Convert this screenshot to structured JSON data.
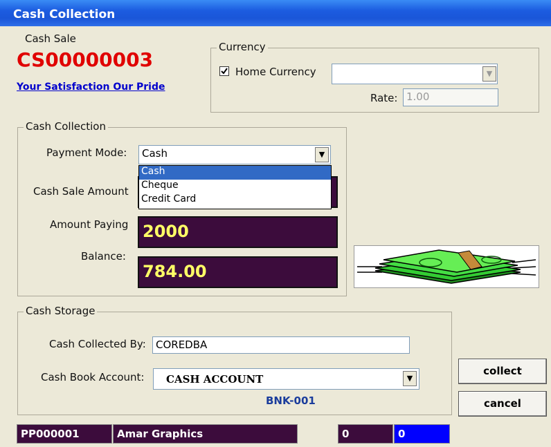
{
  "window": {
    "title": "Cash Collection"
  },
  "header": {
    "doc_type": "Cash Sale",
    "doc_number": "CS00000003",
    "slogan": "Your Satisfaction Our Pride"
  },
  "currency": {
    "legend": "Currency",
    "home_currency_label": "Home Currency",
    "home_currency_checked": true,
    "currency_value": "",
    "rate_label": "Rate:",
    "rate_value": "1.00"
  },
  "collection": {
    "legend": "Cash Collection",
    "payment_mode_label": "Payment Mode:",
    "payment_mode_value": "Cash",
    "payment_mode_options": [
      "Cash",
      "Cheque",
      "Credit Card"
    ],
    "sale_amount_label": "Cash Sale Amount",
    "amount_paying_label": "Amount Paying",
    "amount_paying_value": "2000",
    "balance_label": "Balance:",
    "balance_value": "784.00"
  },
  "storage": {
    "legend": "Cash Storage",
    "collected_by_label": "Cash Collected By:",
    "collected_by_value": "COREDBA",
    "cash_book_label": "Cash Book Account:",
    "cash_book_value": "CASH ACCOUNT",
    "cash_book_code": "BNK-001"
  },
  "buttons": {
    "collect": "collect",
    "cancel": "cancel"
  },
  "status_bar": {
    "party_code": "PP000001",
    "party_name": "Amar Graphics",
    "value1": "0",
    "value2": "0"
  },
  "colors": {
    "title_bar": "#1c5ce0",
    "doc_number": "#e00000",
    "slogan_link": "#0000cc",
    "amount_bg": "#3c0c3c",
    "amount_text": "#ffff66",
    "selected_option": "#316ac5"
  },
  "icons": {
    "currency_checkbox": "check-icon",
    "cash_image": "cash-stack-icon"
  }
}
